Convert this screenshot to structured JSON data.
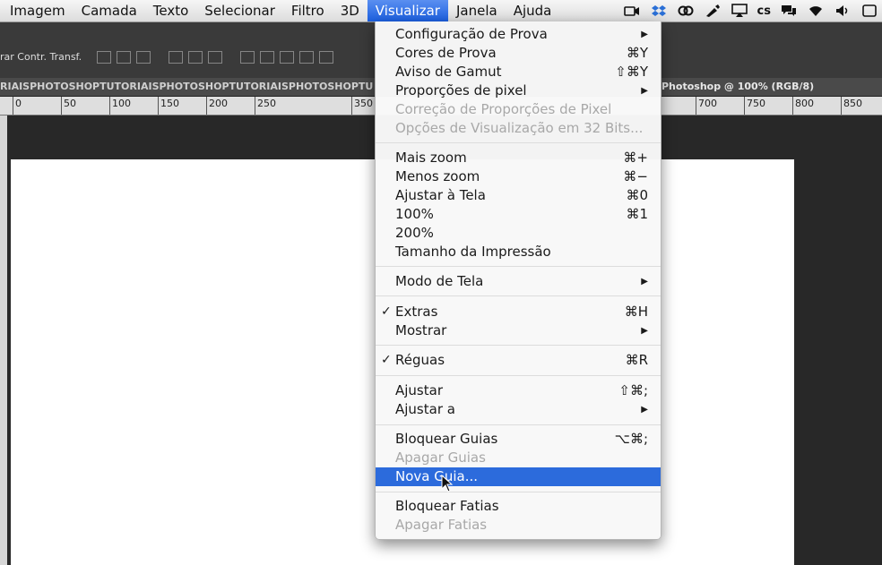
{
  "menubar": {
    "items": [
      "Imagem",
      "Camada",
      "Texto",
      "Selecionar",
      "Filtro",
      "3D",
      "Visualizar",
      "Janela",
      "Ajuda"
    ],
    "active": "Visualizar",
    "status_text": "cs"
  },
  "options": {
    "label": "rar Contr. Transf."
  },
  "doc": {
    "tab_repeat": "RIAISPHOTOSHOPTUTORIAISPHOTOSHOPTUTORIAISPHOTOSHOPTU",
    "tab_title": "Photoshop @ 100% (RGB/8)"
  },
  "ruler": {
    "labels": [
      "0",
      "50",
      "100",
      "150",
      "200",
      "250",
      "350",
      "700",
      "750",
      "800",
      "850"
    ]
  },
  "menu": {
    "items": [
      {
        "label": "Configuração de Prova",
        "submenu": true
      },
      {
        "label": "Cores de Prova",
        "shortcut": "⌘Y"
      },
      {
        "label": "Aviso de Gamut",
        "shortcut": "⇧⌘Y"
      },
      {
        "label": "Proporções de pixel",
        "submenu": true
      },
      {
        "label": "Correção de Proporções de Pixel",
        "disabled": true
      },
      {
        "label": "Opções de Visualização em 32 Bits...",
        "disabled": true
      },
      {
        "label": "Mais zoom",
        "shortcut": "⌘+"
      },
      {
        "label": "Menos zoom",
        "shortcut": "⌘−"
      },
      {
        "label": "Ajustar à Tela",
        "shortcut": "⌘0"
      },
      {
        "label": "100%",
        "shortcut": "⌘1"
      },
      {
        "label": "200%"
      },
      {
        "label": "Tamanho da Impressão"
      },
      {
        "label": "Modo de Tela",
        "submenu": true
      },
      {
        "label": "Extras",
        "shortcut": "⌘H",
        "checked": true
      },
      {
        "label": "Mostrar",
        "submenu": true
      },
      {
        "label": "Réguas",
        "shortcut": "⌘R",
        "checked": true
      },
      {
        "label": "Ajustar",
        "shortcut": "⇧⌘;"
      },
      {
        "label": "Ajustar a",
        "submenu": true
      },
      {
        "label": "Bloquear Guias",
        "shortcut": "⌥⌘;"
      },
      {
        "label": "Apagar Guias",
        "disabled": true
      },
      {
        "label": "Nova Guia...",
        "highlighted": true
      },
      {
        "label": "Bloquear Fatias"
      },
      {
        "label": "Apagar Fatias",
        "disabled": true
      }
    ]
  },
  "colors": {
    "menu_highlight": "#2c6bdc",
    "active_menu": "#1b5fe0",
    "disabled_text": "#a8a8a8"
  }
}
